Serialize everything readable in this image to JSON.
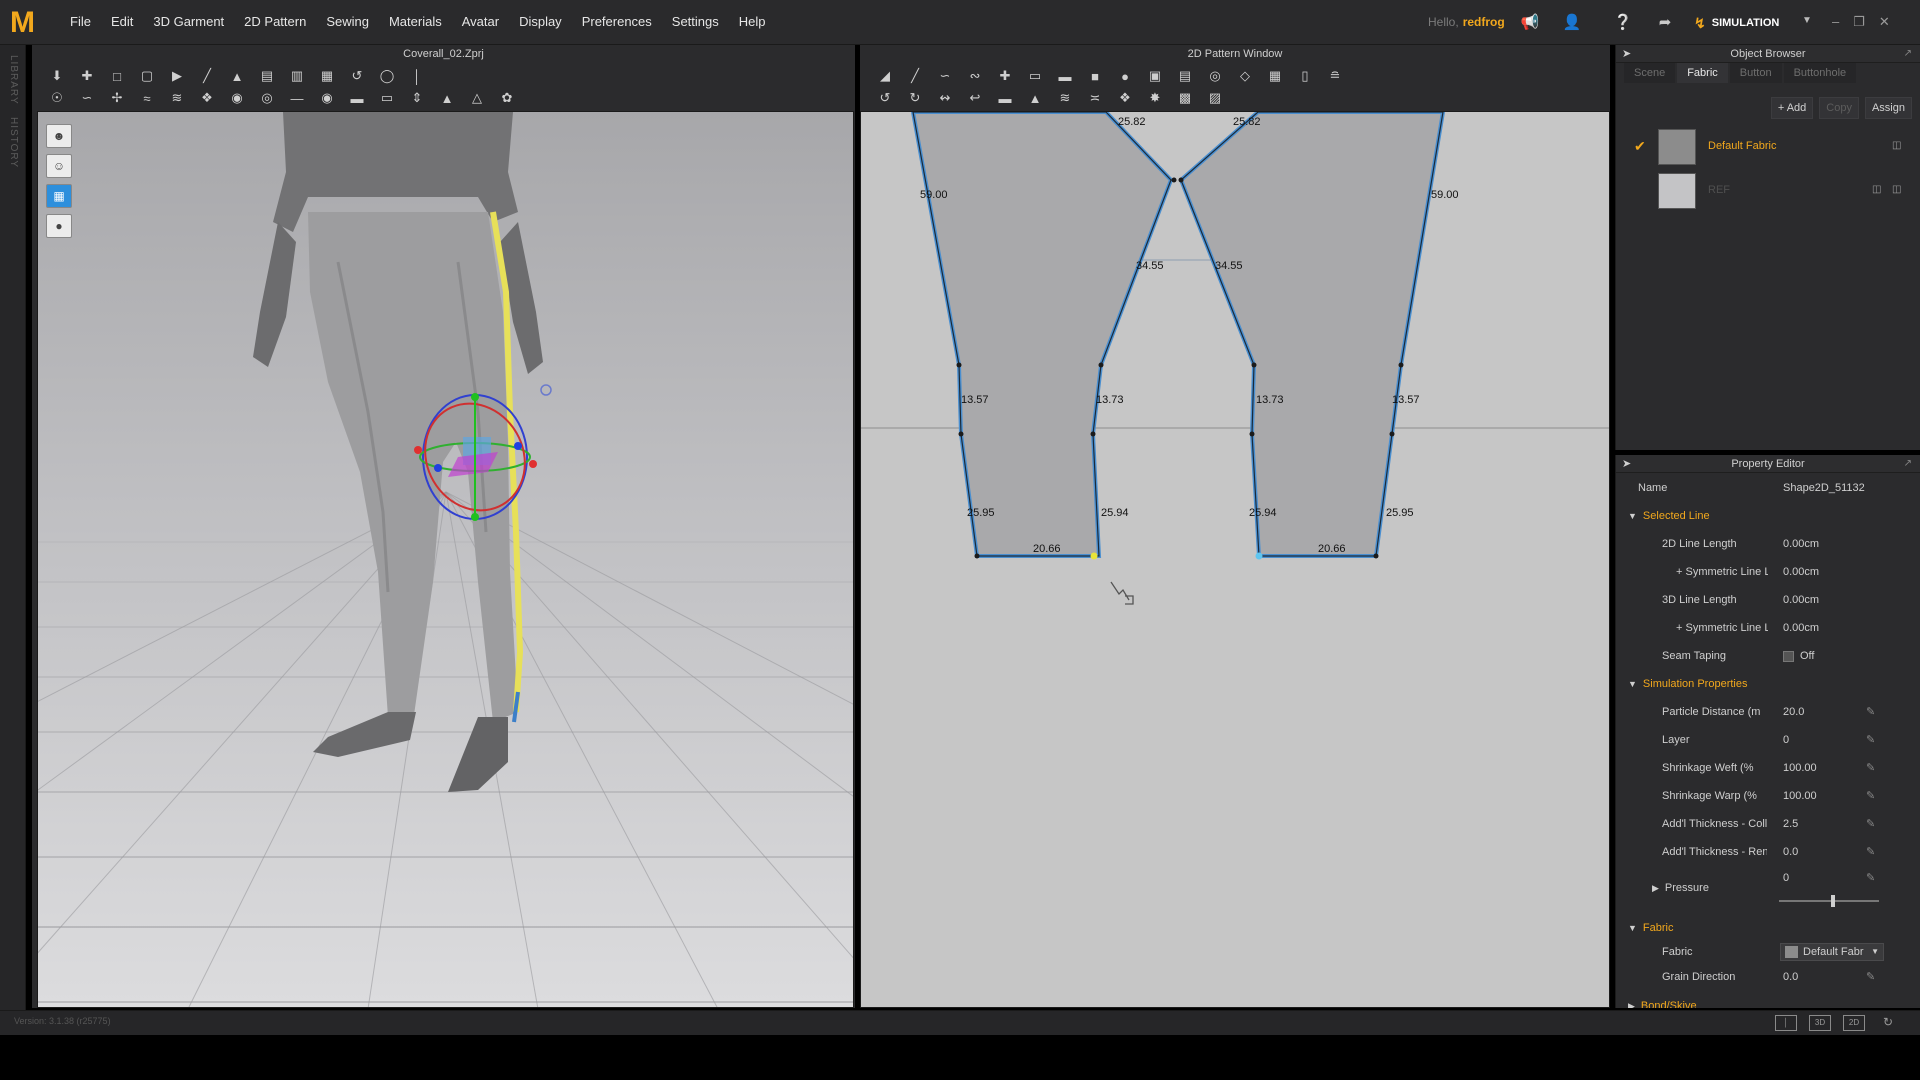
{
  "menubar": {
    "logo": "M",
    "menus": [
      "File",
      "Edit",
      "3D Garment",
      "2D Pattern",
      "Sewing",
      "Materials",
      "Avatar",
      "Display",
      "Preferences",
      "Settings",
      "Help"
    ],
    "greeting": "Hello,",
    "username": "redfrog",
    "mode_label": "SIMULATION"
  },
  "leftstrip": {
    "labels": [
      "LIBRARY",
      "HISTORY"
    ]
  },
  "window3d": {
    "title": "Coverall_02.Zprj"
  },
  "window2d": {
    "title": "2D Pattern Window",
    "measurements": {
      "top_left": "25.82",
      "top_right": "25.82",
      "outer_left": "59.00",
      "outer_right": "59.00",
      "crotch_left": "34.55",
      "crotch_right": "34.55",
      "knee_ol": "13.57",
      "knee_il": "13.73",
      "knee_ir": "13.73",
      "knee_or": "13.57",
      "calf_ol": "25.95",
      "calf_il": "25.94",
      "calf_ir": "25.94",
      "calf_or": "25.95",
      "hem_left": "20.66",
      "hem_right": "20.66"
    }
  },
  "object_browser": {
    "title": "Object Browser",
    "tabs": [
      "Scene",
      "Fabric",
      "Button",
      "Buttonhole"
    ],
    "active_tab": "Fabric",
    "actions": {
      "add": "+ Add",
      "copy": "Copy",
      "assign": "Assign"
    },
    "fabrics": [
      {
        "name": "Default Fabric",
        "selected": true
      },
      {
        "name": "REF",
        "selected": false
      }
    ]
  },
  "property_editor": {
    "title": "Property Editor",
    "name_label": "Name",
    "name_value": "Shape2D_51132",
    "selected_line": {
      "header": "Selected Line",
      "line2d_label": "2D Line Length",
      "line2d_value": "0.00cm",
      "sym1_label": "+ Symmetric Line Le",
      "sym1_value": "0.00cm",
      "line3d_label": "3D Line Length",
      "line3d_value": "0.00cm",
      "sym2_label": "+ Symmetric Line Le",
      "sym2_value": "0.00cm",
      "seam_label": "Seam Taping",
      "seam_value": "Off"
    },
    "simulation": {
      "header": "Simulation Properties",
      "particle_label": "Particle Distance (m",
      "particle_value": "20.0",
      "layer_label": "Layer",
      "layer_value": "0",
      "weft_label": "Shrinkage Weft (%",
      "weft_value": "100.00",
      "warp_label": "Shrinkage Warp (%",
      "warp_value": "100.00",
      "thick_col_label": "Add'l Thickness - Collisic",
      "thick_col_value": "2.5",
      "thick_ren_label": "Add'l Thickness - Render",
      "thick_ren_value": "0.0",
      "pressure_label": "Pressure",
      "pressure_value": "0"
    },
    "fabric": {
      "header": "Fabric",
      "fabric_label": "Fabric",
      "fabric_value": "Default Fabr",
      "grain_label": "Grain Direction",
      "grain_value": "0.0"
    },
    "next_header": "Bond/Skive"
  },
  "statusbar": {
    "version": "Version: 3.1.38 (r25775)"
  }
}
